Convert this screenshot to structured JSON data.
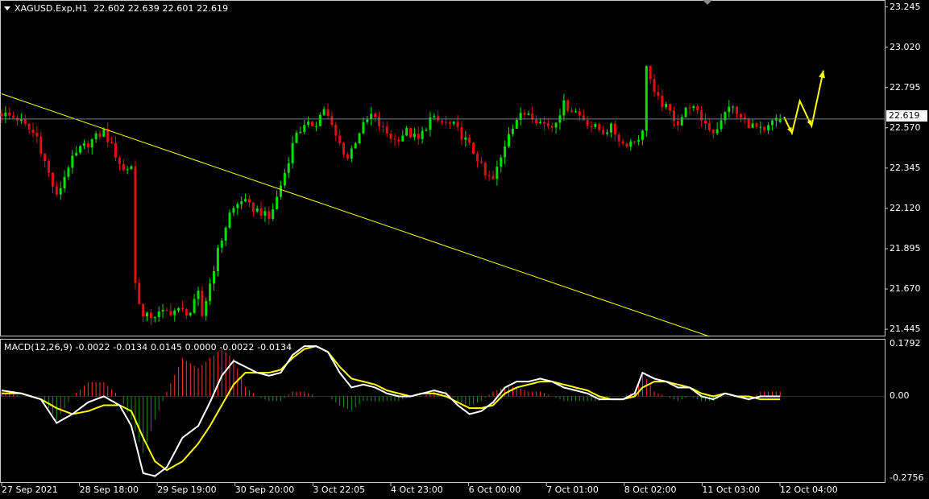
{
  "window": {
    "symbol_header": "XAGUSD.Exp,H1  22.602 22.639 22.601 22.619",
    "macd_header": "MACD(12,26,9) -0.0022 -0.0134 0.0145 0.0000 -0.0022 -0.0134",
    "current_price_label": "22.619"
  },
  "colors": {
    "background": "#000000",
    "frame": "#c8c8c8",
    "bull": "#00e000",
    "bear": "#e01010",
    "trendline": "#ffff00",
    "arrows": "#ffff00",
    "price_line": "#6d7f98",
    "macd_line": "#ffffff",
    "signal_line": "#ffff00",
    "hist_pos": "#ff3030",
    "hist_neg": "#1f8f1f"
  },
  "chart_data": [
    {
      "type": "candlestick",
      "symbol": "XAGUSD.Exp",
      "timeframe": "H1",
      "ohlc_last": {
        "open": 22.602,
        "high": 22.639,
        "low": 22.601,
        "close": 22.619
      },
      "y_ticks": [
        23.245,
        23.02,
        22.795,
        22.57,
        22.345,
        22.12,
        21.895,
        21.67,
        21.445
      ],
      "ylim": [
        21.405,
        23.279
      ],
      "current_price": 22.619,
      "x_ticks": [
        "27 Sep 2021",
        "28 Sep 18:00",
        "29 Sep 19:00",
        "30 Sep 20:00",
        "3 Oct 22:05",
        "4 Oct 23:00",
        "6 Oct 00:00",
        "7 Oct 01:00",
        "8 Oct 02:00",
        "11 Oct 03:00",
        "12 Oct 04:00"
      ],
      "close_path": [
        [
          0,
          22.65
        ],
        [
          4,
          22.62
        ],
        [
          9,
          22.52
        ],
        [
          11,
          22.38
        ],
        [
          14,
          22.18
        ],
        [
          17,
          22.36
        ],
        [
          20,
          22.45
        ],
        [
          23,
          22.5
        ],
        [
          26,
          22.55
        ],
        [
          29,
          22.42
        ],
        [
          31,
          22.33
        ],
        [
          33,
          22.36
        ],
        [
          34,
          21.7
        ],
        [
          36,
          21.51
        ],
        [
          40,
          21.53
        ],
        [
          44,
          21.55
        ],
        [
          48,
          21.54
        ],
        [
          50,
          21.64
        ],
        [
          51,
          21.52
        ],
        [
          53,
          21.7
        ],
        [
          55,
          21.88
        ],
        [
          58,
          22.09
        ],
        [
          61,
          22.17
        ],
        [
          63,
          22.13
        ],
        [
          66,
          22.1
        ],
        [
          68,
          22.06
        ],
        [
          70,
          22.18
        ],
        [
          72,
          22.32
        ],
        [
          75,
          22.55
        ],
        [
          78,
          22.58
        ],
        [
          80,
          22.6
        ],
        [
          82,
          22.68
        ],
        [
          85,
          22.52
        ],
        [
          88,
          22.4
        ],
        [
          91,
          22.55
        ],
        [
          94,
          22.64
        ],
        [
          97,
          22.56
        ],
        [
          100,
          22.5
        ],
        [
          103,
          22.55
        ],
        [
          106,
          22.5
        ],
        [
          109,
          22.62
        ],
        [
          112,
          22.6
        ],
        [
          115,
          22.58
        ],
        [
          118,
          22.5
        ],
        [
          121,
          22.4
        ],
        [
          123,
          22.3
        ],
        [
          125,
          22.28
        ],
        [
          127,
          22.4
        ],
        [
          129,
          22.55
        ],
        [
          131,
          22.62
        ],
        [
          134,
          22.66
        ],
        [
          137,
          22.6
        ],
        [
          140,
          22.58
        ],
        [
          143,
          22.7
        ],
        [
          146,
          22.66
        ],
        [
          148,
          22.62
        ],
        [
          150,
          22.58
        ],
        [
          153,
          22.55
        ],
        [
          155,
          22.57
        ],
        [
          158,
          22.48
        ],
        [
          161,
          22.5
        ],
        [
          163,
          22.54
        ],
        [
          164,
          22.93
        ],
        [
          166,
          22.75
        ],
        [
          169,
          22.68
        ],
        [
          172,
          22.6
        ],
        [
          175,
          22.7
        ],
        [
          178,
          22.62
        ],
        [
          181,
          22.55
        ],
        [
          183,
          22.6
        ],
        [
          185,
          22.7
        ],
        [
          188,
          22.62
        ],
        [
          191,
          22.58
        ],
        [
          194,
          22.54
        ],
        [
          196,
          22.6
        ],
        [
          198,
          22.62
        ]
      ],
      "trendline": {
        "from": [
          0,
          22.76
        ],
        "to": [
          180,
          21.405
        ]
      },
      "annotations": [
        {
          "type": "zigzag-arrow",
          "points": [
            [
              199,
              22.63
            ],
            [
              201,
              22.54
            ],
            [
              203,
              22.72
            ],
            [
              206,
              22.58
            ],
            [
              209,
              22.89
            ]
          ]
        }
      ]
    },
    {
      "type": "macd",
      "params": "12,26,9",
      "y_ticks": [
        0.1792,
        0.0,
        -0.2756
      ],
      "ylim": [
        -0.293,
        0.192
      ],
      "macd_path": [
        [
          0,
          0.02
        ],
        [
          5,
          0.01
        ],
        [
          10,
          -0.01
        ],
        [
          14,
          -0.09
        ],
        [
          18,
          -0.06
        ],
        [
          22,
          -0.02
        ],
        [
          26,
          0.0
        ],
        [
          30,
          -0.03
        ],
        [
          33,
          -0.1
        ],
        [
          36,
          -0.26
        ],
        [
          39,
          -0.27
        ],
        [
          42,
          -0.24
        ],
        [
          46,
          -0.14
        ],
        [
          50,
          -0.1
        ],
        [
          53,
          -0.02
        ],
        [
          56,
          0.07
        ],
        [
          59,
          0.12
        ],
        [
          62,
          0.1
        ],
        [
          65,
          0.08
        ],
        [
          68,
          0.07
        ],
        [
          71,
          0.08
        ],
        [
          74,
          0.14
        ],
        [
          77,
          0.17
        ],
        [
          80,
          0.17
        ],
        [
          83,
          0.15
        ],
        [
          86,
          0.08
        ],
        [
          89,
          0.03
        ],
        [
          92,
          0.04
        ],
        [
          95,
          0.03
        ],
        [
          98,
          0.01
        ],
        [
          101,
          0.0
        ],
        [
          104,
          0.0
        ],
        [
          107,
          0.01
        ],
        [
          110,
          0.02
        ],
        [
          113,
          0.01
        ],
        [
          116,
          -0.03
        ],
        [
          119,
          -0.06
        ],
        [
          122,
          -0.05
        ],
        [
          125,
          -0.02
        ],
        [
          128,
          0.03
        ],
        [
          131,
          0.05
        ],
        [
          134,
          0.05
        ],
        [
          137,
          0.06
        ],
        [
          140,
          0.05
        ],
        [
          143,
          0.03
        ],
        [
          146,
          0.02
        ],
        [
          149,
          0.01
        ],
        [
          152,
          -0.01
        ],
        [
          155,
          -0.01
        ],
        [
          158,
          -0.01
        ],
        [
          161,
          0.01
        ],
        [
          163,
          0.08
        ],
        [
          166,
          0.06
        ],
        [
          169,
          0.05
        ],
        [
          172,
          0.03
        ],
        [
          175,
          0.03
        ],
        [
          178,
          0.0
        ],
        [
          181,
          -0.01
        ],
        [
          184,
          0.01
        ],
        [
          187,
          0.0
        ],
        [
          190,
          -0.01
        ],
        [
          193,
          0.0
        ],
        [
          196,
          0.0
        ],
        [
          198,
          0.0
        ]
      ],
      "signal_path": [
        [
          0,
          0.01
        ],
        [
          5,
          0.01
        ],
        [
          10,
          -0.01
        ],
        [
          14,
          -0.04
        ],
        [
          18,
          -0.06
        ],
        [
          22,
          -0.05
        ],
        [
          26,
          -0.03
        ],
        [
          30,
          -0.03
        ],
        [
          33,
          -0.05
        ],
        [
          36,
          -0.14
        ],
        [
          39,
          -0.22
        ],
        [
          42,
          -0.25
        ],
        [
          46,
          -0.22
        ],
        [
          50,
          -0.16
        ],
        [
          53,
          -0.1
        ],
        [
          56,
          -0.03
        ],
        [
          59,
          0.04
        ],
        [
          62,
          0.08
        ],
        [
          65,
          0.08
        ],
        [
          68,
          0.08
        ],
        [
          71,
          0.09
        ],
        [
          74,
          0.13
        ],
        [
          77,
          0.16
        ],
        [
          80,
          0.17
        ],
        [
          83,
          0.15
        ],
        [
          86,
          0.1
        ],
        [
          89,
          0.06
        ],
        [
          92,
          0.05
        ],
        [
          95,
          0.04
        ],
        [
          98,
          0.02
        ],
        [
          101,
          0.01
        ],
        [
          104,
          0.0
        ],
        [
          107,
          0.01
        ],
        [
          110,
          0.01
        ],
        [
          113,
          0.0
        ],
        [
          116,
          -0.02
        ],
        [
          119,
          -0.04
        ],
        [
          122,
          -0.04
        ],
        [
          125,
          -0.03
        ],
        [
          128,
          0.01
        ],
        [
          131,
          0.03
        ],
        [
          134,
          0.04
        ],
        [
          137,
          0.05
        ],
        [
          140,
          0.05
        ],
        [
          143,
          0.04
        ],
        [
          146,
          0.03
        ],
        [
          149,
          0.02
        ],
        [
          152,
          0.0
        ],
        [
          155,
          -0.01
        ],
        [
          158,
          -0.01
        ],
        [
          161,
          0.0
        ],
        [
          163,
          0.03
        ],
        [
          166,
          0.05
        ],
        [
          169,
          0.05
        ],
        [
          172,
          0.04
        ],
        [
          175,
          0.03
        ],
        [
          178,
          0.01
        ],
        [
          181,
          0.0
        ],
        [
          184,
          0.01
        ],
        [
          187,
          0.0
        ],
        [
          190,
          0.0
        ],
        [
          193,
          -0.01
        ],
        [
          196,
          -0.01
        ],
        [
          198,
          -0.01
        ]
      ]
    }
  ]
}
